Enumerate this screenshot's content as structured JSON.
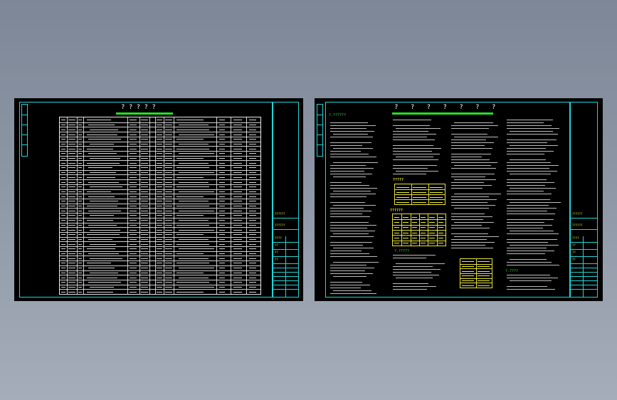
{
  "sheet_left": {
    "title": "? ? ? ? ?",
    "stamp_labels": [
      "??????",
      "??????",
      "????",
      "??",
      "??",
      "??"
    ]
  },
  "sheet_right": {
    "title": "? ? ? ? ? ? ?",
    "sections": [
      "?.??????",
      "?.?????",
      "?.????"
    ],
    "table_labels": [
      "?????",
      "??????"
    ],
    "stamp_labels": [
      "??????",
      "??????",
      "????",
      "??",
      "??",
      "??"
    ]
  },
  "colors": {
    "frame": "#22d5d5",
    "title_bar": "#23e023",
    "annotation": "#f0f03a",
    "section": "#2be24a",
    "background": "#8d96a5"
  }
}
